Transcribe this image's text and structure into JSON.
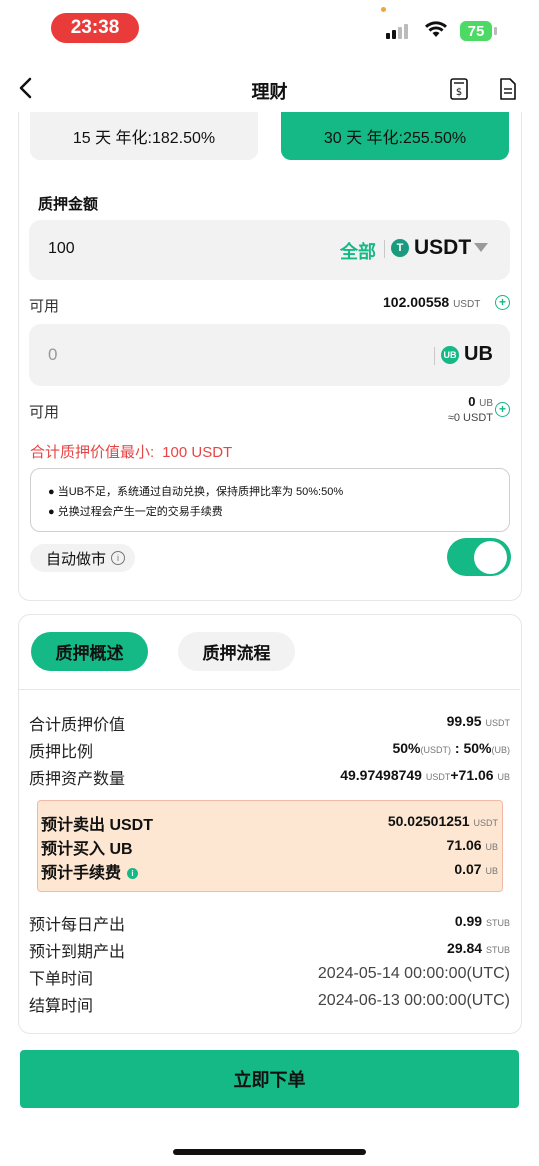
{
  "status_bar": {
    "time": "23:38",
    "battery": "75"
  },
  "nav": {
    "title": "理财",
    "back_icon": "chevron-left-icon",
    "right_icons": [
      "calculator-receipt-icon",
      "document-icon"
    ]
  },
  "terms": [
    {
      "label": "15 天 年化:182.50%",
      "selected": false
    },
    {
      "label": "30 天 年化:255.50%",
      "selected": true
    }
  ],
  "pledge": {
    "label": "质押金额",
    "amount_value": "100",
    "all_label": "全部",
    "currency": "USDT",
    "available_label": "可用",
    "available_value": "102.00558",
    "available_unit": "USDT",
    "ub_placeholder": "0",
    "ub_currency": "UB",
    "ub_available_label": "可用",
    "ub_available_value": "0",
    "ub_available_unit": "UB",
    "ub_available_approx": "≈0 USDT",
    "min_value_label": "合计质押价值最小:",
    "min_value": "100 USDT",
    "notices": [
      "● 当UB不足，系统通过自动兑换，保持质押比率为 50%:50%",
      "● 兑换过程会产生一定的交易手续费"
    ],
    "auto_market_label": "自动做市",
    "auto_market_on": true
  },
  "overview": {
    "tabs": [
      "质押概述",
      "质押流程"
    ],
    "total_value_label": "合计质押价值",
    "total_value": "99.95",
    "total_value_unit": "USDT",
    "ratio_label": "质押比例",
    "ratio_a": "50%",
    "ratio_a_unit": "(USDT)",
    "ratio_sep": " : ",
    "ratio_b": "50%",
    "ratio_b_unit": "(UB)",
    "asset_qty_label": "质押资产数量",
    "asset_qty_a": "49.97498749",
    "asset_qty_a_unit": "USDT",
    "asset_qty_b": "+71.06",
    "asset_qty_b_unit": "UB",
    "estimates": [
      {
        "label": "预计卖出 USDT",
        "value": "50.02501251",
        "unit": "USDT"
      },
      {
        "label": "预计买入 UB",
        "value": "71.06",
        "unit": "UB"
      },
      {
        "label": "预计手续费",
        "value": "0.07",
        "unit": "UB"
      }
    ],
    "daily_label": "预计每日产出",
    "daily_value": "0.99",
    "daily_unit": "STUB",
    "maturity_label": "预计到期产出",
    "maturity_value": "29.84",
    "maturity_unit": "STUB",
    "order_time_label": "下单时间",
    "order_time": "2024-05-14 00:00:00(UTC)",
    "settle_time_label": "结算时间",
    "settle_time": "2024-06-13 00:00:00(UTC)"
  },
  "submit_label": "立即下单",
  "colors": {
    "accent": "#15b985",
    "danger": "#e64545",
    "status_pill": "#ea3b3b",
    "estimate_bg": "#fde7d2"
  }
}
